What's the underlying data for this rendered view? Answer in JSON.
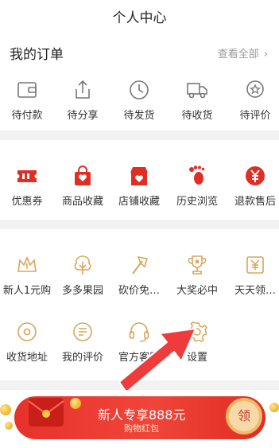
{
  "header": {
    "title": "个人中心"
  },
  "orders": {
    "title": "我的订单",
    "view_all": "查看全部",
    "items": [
      {
        "label": "待付款",
        "icon": "wallet-icon"
      },
      {
        "label": "待分享",
        "icon": "share-icon"
      },
      {
        "label": "待发货",
        "icon": "clock-icon"
      },
      {
        "label": "待收货",
        "icon": "truck-icon"
      },
      {
        "label": "待评价",
        "icon": "star-badge-icon"
      }
    ]
  },
  "favorites": {
    "items": [
      {
        "label": "优惠券",
        "icon": "coupon-icon"
      },
      {
        "label": "商品收藏",
        "icon": "shopping-bag-heart-icon"
      },
      {
        "label": "店铺收藏",
        "icon": "store-heart-icon"
      },
      {
        "label": "历史浏览",
        "icon": "footprint-icon"
      },
      {
        "label": "退款售后",
        "icon": "yen-refund-icon"
      }
    ]
  },
  "tools": {
    "row1": [
      {
        "label": "新人1元购",
        "icon": "crown-icon"
      },
      {
        "label": "多多果园",
        "icon": "tree-icon"
      },
      {
        "label": "砍价免…",
        "icon": "axe-icon"
      },
      {
        "label": "大奖必中",
        "icon": "trophy-icon"
      },
      {
        "label": "天天领…",
        "icon": "yen-coupon-icon"
      }
    ],
    "row2": [
      {
        "label": "收货地址",
        "icon": "location-icon"
      },
      {
        "label": "我的评价",
        "icon": "comment-list-icon"
      },
      {
        "label": "官方客服",
        "icon": "headset-icon"
      },
      {
        "label": "设置",
        "icon": "gear-icon"
      }
    ]
  },
  "banner": {
    "main": "新人专享888元",
    "sub": "购物红包",
    "claim": "领"
  },
  "colors": {
    "accent_red": "#e02e24",
    "icon_gold": "#d9a55b",
    "icon_gray": "#777777",
    "arrow_red": "#ee3b3b"
  }
}
